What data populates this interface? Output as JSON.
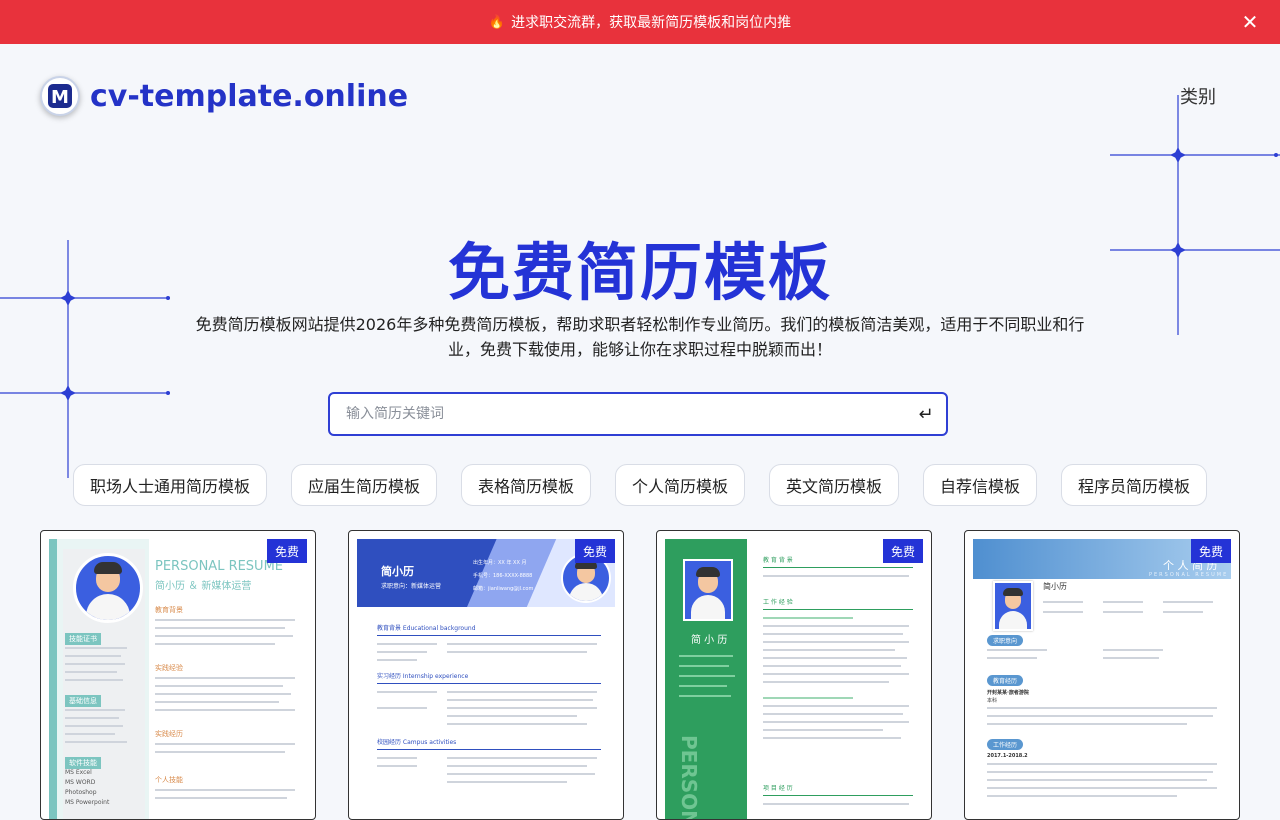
{
  "banner": {
    "text": "进求职交流群，获取最新简历模板和岗位内推",
    "icon": "fire-icon"
  },
  "header": {
    "logo_letter": "M",
    "site_name": "cv-template.online",
    "nav_category": "类别"
  },
  "hero": {
    "title": "免费简历模板",
    "description": "免费简历模板网站提供2026年多种免费简历模板，帮助求职者轻松制作专业简历。我们的模板简洁美观，适用于不同职业和行业，免费下载使用，能够让你在求职过程中脱颖而出！"
  },
  "search": {
    "placeholder": "输入简历关键词",
    "submit_icon": "enter-icon"
  },
  "categories": [
    "职场人士通用简历模板",
    "应届生简历模板",
    "表格简历模板",
    "个人简历模板",
    "英文简历模板",
    "自荐信模板",
    "程序员简历模板"
  ],
  "cards": [
    {
      "badge": "免费",
      "heading": "PERSONAL RESUME",
      "subheading": "简小历 ＆ 新媒体运营",
      "sections": [
        "教育背景",
        "实践经验",
        "实践经历",
        "个人技能"
      ],
      "side_sections": [
        "技能证书",
        "基础信息",
        "软件技能"
      ],
      "side_skills": [
        "MS Excel",
        "MS WORD",
        "Photoshop",
        "MS Powerpoint"
      ],
      "accent": "#7cc5c0"
    },
    {
      "badge": "免费",
      "name": "简小历",
      "intent": "求职意向：新媒体运营",
      "sections": [
        "教育背景 Educational background",
        "实习经历 Internship experience",
        "校园经历 Campus activities"
      ],
      "contacts": [
        "出生年月：XX 年 XX 月",
        "手机号：186-XXXX-8888",
        "邮箱：jianliwang@jl.com"
      ],
      "accent": "#2f4fbf"
    },
    {
      "badge": "免费",
      "name": "简 小 历",
      "vertical_text": "PERSON",
      "sections": [
        "教 育 背 景",
        "工 作 经 验",
        "项 目 经 历"
      ],
      "accent": "#2e9e5e"
    },
    {
      "badge": "免费",
      "title": "个 人 简 历",
      "title_en": "PERSONAL RESUME",
      "name": "简小历",
      "sections": [
        "求职意向",
        "教育经历",
        "工作经历"
      ],
      "school": "开封某某·旅者游院",
      "degree": "本科",
      "years": "2017.1-2018.2",
      "accent": "#5a97d0"
    }
  ],
  "colors": {
    "banner": "#e8323c",
    "brand": "#2433d6",
    "badge": "#2433d6"
  }
}
